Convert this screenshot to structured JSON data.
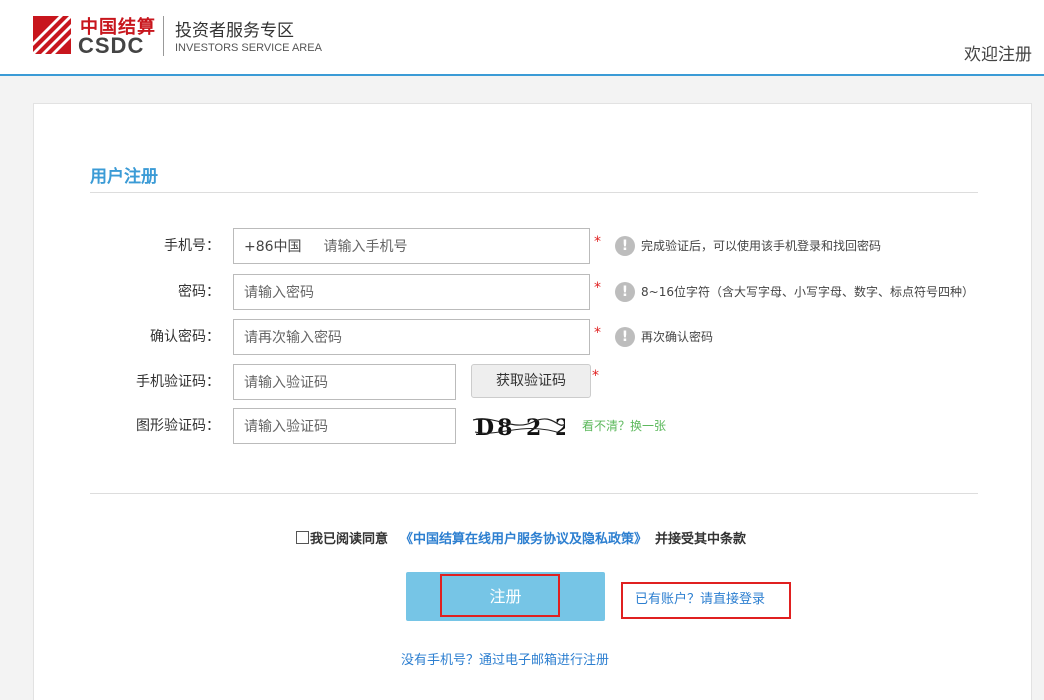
{
  "header": {
    "logo_cn": "中国结算",
    "logo_en": "CSDC",
    "area_title": "投资者服务专区",
    "area_subtitle": "INVESTORS SERVICE AREA",
    "welcome": "欢迎注册"
  },
  "form": {
    "title": "用户注册",
    "phone": {
      "label": "手机号：",
      "prefix": "+86中国",
      "placeholder": "请输入手机号",
      "required": "*",
      "hint": "完成验证后，可以使用该手机登录和找回密码"
    },
    "password": {
      "label": "密码：",
      "placeholder": "请输入密码",
      "required": "*",
      "hint": "8~16位字符（含大写字母、小写字母、数字、标点符号四种）"
    },
    "confirm": {
      "label": "确认密码：",
      "placeholder": "请再次输入密码",
      "required": "*",
      "hint": "再次确认密码"
    },
    "sms_code": {
      "label": "手机验证码：",
      "placeholder": "请输入验证码",
      "button": "获取验证码",
      "required": "*"
    },
    "image_code": {
      "label": "图形验证码：",
      "placeholder": "请输入验证码",
      "captcha_text": "D8 2 2",
      "refresh": "看不清？换一张"
    },
    "agree": {
      "text": "我已阅读同意",
      "policy": "《中国结算在线用户服务协议及隐私政策》",
      "suffix": "并接受其中条款"
    },
    "register_button": "注册",
    "login_link": "已有账户？请直接登录",
    "email_link": "没有手机号？通过电子邮箱进行注册"
  },
  "colors": {
    "accent": "#3b9bd6",
    "button": "#76c5e6",
    "link": "#2d7fd0",
    "brand_red": "#c8161d",
    "highlight_box": "#e02020"
  }
}
